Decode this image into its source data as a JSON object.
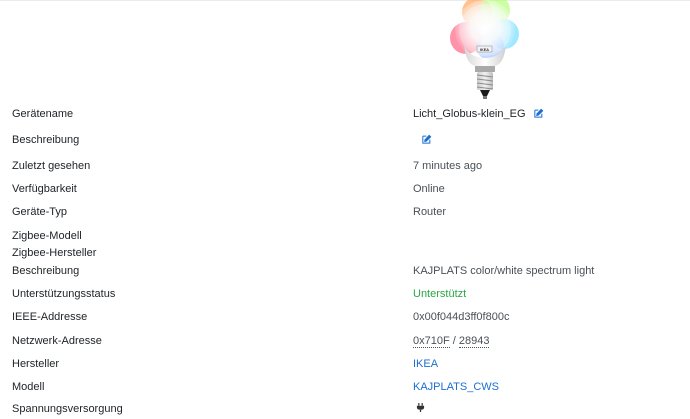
{
  "device": {
    "image_icon": "bulb-icon",
    "image_text": "IKEA",
    "accent_color": "#1c6fd1",
    "success_color": "#28a745"
  },
  "rows": [
    {
      "label": "Gerätename",
      "value": "Licht_Globus-klein_EG",
      "edit_icon": "edit-icon"
    },
    {
      "label": "Beschreibung",
      "value": "",
      "edit_icon": "edit-icon"
    },
    {
      "label": "Zuletzt gesehen",
      "value": "7 minutes ago"
    },
    {
      "label": "Verfügbarkeit",
      "value": "Online"
    },
    {
      "label": "Geräte-Typ",
      "value": "Router"
    },
    {
      "label": "Zigbee-Modell",
      "value": ""
    },
    {
      "label": "Zigbee-Hersteller",
      "value": ""
    },
    {
      "label": "Beschreibung",
      "value": "KAJPLATS color/white spectrum light"
    },
    {
      "label": "Unterstützungsstatus",
      "value": "Unterstützt"
    },
    {
      "label": "IEEE-Addresse",
      "value": "0x00f044d3ff0f800c"
    },
    {
      "label": "Netzwerk-Adresse",
      "value_hex": "0x710F",
      "separator": "/",
      "value_dec": "28943"
    },
    {
      "label": "Hersteller",
      "value": "IKEA"
    },
    {
      "label": "Modell",
      "value": "KAJPLATS_CWS"
    },
    {
      "label": "Spannungsversorgung",
      "value_icon": "plug-icon"
    }
  ]
}
